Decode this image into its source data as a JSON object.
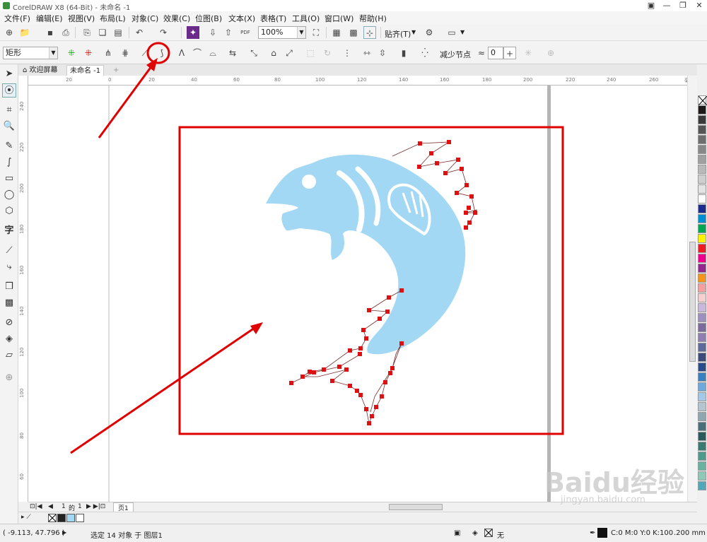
{
  "titlebar": {
    "title": "CorelDRAW X8 (64-Bit) - 未命名 -1"
  },
  "menubar": {
    "items": [
      "文件(F)",
      "编辑(E)",
      "视图(V)",
      "布局(L)",
      "对象(C)",
      "效果(C)",
      "位图(B)",
      "文本(X)",
      "表格(T)",
      "工具(O)",
      "窗口(W)",
      "帮助(H)"
    ]
  },
  "toolbar1": {
    "zoom": "100%",
    "snap_label": "贴齐(T)"
  },
  "toolbar2": {
    "object_type": "矩形",
    "reduce_nodes_label": "减少节点",
    "curve_smoothness": "0"
  },
  "tabs": {
    "welcome": "欢迎屏幕",
    "doc": "未命名 -1"
  },
  "ruler": {
    "unit": "毫米",
    "h_labels": [
      "20",
      "0",
      "20",
      "40",
      "60",
      "80",
      "100",
      "120",
      "140",
      "160",
      "180",
      "200",
      "220",
      "240",
      "260"
    ],
    "v_labels": [
      "240",
      "220",
      "200",
      "180",
      "160",
      "140",
      "120",
      "100",
      "80",
      "60"
    ]
  },
  "pagenav": {
    "current": "1",
    "of": "的",
    "total": "1",
    "page_tab": "页1"
  },
  "statusbar": {
    "coords": "( -9.113, 47.796 )",
    "selection": "选定 14 对象 于 图层1",
    "fill_none": "无",
    "outline_color": "C:0 M:0 Y:0 K:100",
    "outline_width": ".200 mm"
  },
  "watermark": {
    "brand": "Baidu经验",
    "url": "jingyan.baidu.com"
  },
  "colors": {
    "fish": "#a3d8f4",
    "accent_red": "#e00000",
    "node_red": "#dd1111"
  }
}
